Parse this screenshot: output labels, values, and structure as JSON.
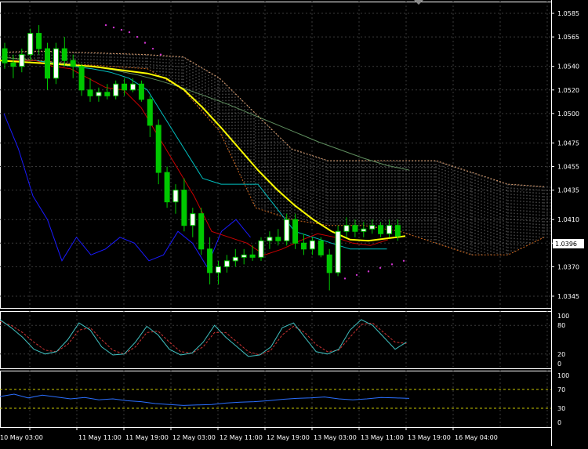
{
  "price_axis": {
    "labels": [
      "1.0585",
      "1.0565",
      "1.0540",
      "1.0520",
      "1.0500",
      "1.0475",
      "1.0455",
      "1.0435",
      "1.0410",
      "1.0390",
      "1.0370",
      "1.0345"
    ],
    "current_price": "1.0396"
  },
  "stoch_axis": {
    "labels": [
      "100",
      "80",
      "20",
      "0"
    ]
  },
  "rsi_axis": {
    "labels": [
      "100",
      "70",
      "30",
      "0"
    ]
  },
  "time_axis": {
    "labels": [
      "10 May 03:00",
      "11 May 11:00",
      "11 May 19:00",
      "12 May 03:00",
      "12 May 11:00",
      "12 May 19:00",
      "13 May 03:00",
      "13 May 11:00",
      "13 May 19:00",
      "16 May 04:00"
    ]
  },
  "colors": {
    "background": "#000000",
    "grid": "#3a3a3a",
    "axis_text": "#ffffff",
    "candle_bull": "#ffffff",
    "candle_bear": "#00c800",
    "ma_slow": "#ffff00",
    "tenkan": "#cc0000",
    "kijun": "#00c0c0",
    "chikou": "#1a1aff",
    "kumo": "#f0f0f0",
    "kumo_lower": "#d26a20",
    "psar": "#cc33cc",
    "ma_long": "#5f8f5f",
    "stoch_main": "#40c0c0",
    "stoch_signal": "#cc3333",
    "rsi_line": "#2a6fff",
    "level_line": "#c8c800"
  },
  "chart_data": [
    {
      "type": "line",
      "name_hint": "main-price-candles",
      "ylim": [
        1.0335,
        1.0595
      ],
      "candles": [
        [
          1.0555,
          1.056,
          1.0538,
          1.0543
        ],
        [
          1.0543,
          1.055,
          1.053,
          1.054
        ],
        [
          1.054,
          1.0555,
          1.0535,
          1.055
        ],
        [
          1.055,
          1.0572,
          1.0545,
          1.0568
        ],
        [
          1.0568,
          1.0575,
          1.055,
          1.0555
        ],
        [
          1.0555,
          1.056,
          1.052,
          1.053
        ],
        [
          1.053,
          1.056,
          1.0525,
          1.0555
        ],
        [
          1.0555,
          1.0565,
          1.054,
          1.0545
        ],
        [
          1.0545,
          1.055,
          1.053,
          1.054
        ],
        [
          1.054,
          1.0542,
          1.0515,
          1.052
        ],
        [
          1.052,
          1.053,
          1.051,
          1.0515
        ],
        [
          1.0515,
          1.0522,
          1.051,
          1.0518
        ],
        [
          1.0518,
          1.0525,
          1.0512,
          1.0515
        ],
        [
          1.0515,
          1.0528,
          1.0512,
          1.0525
        ],
        [
          1.0525,
          1.053,
          1.0515,
          1.052
        ],
        [
          1.052,
          1.053,
          1.0518,
          1.0525
        ],
        [
          1.0525,
          1.0528,
          1.051,
          1.0512
        ],
        [
          1.0512,
          1.0515,
          1.048,
          1.049
        ],
        [
          1.049,
          1.0495,
          1.044,
          1.045
        ],
        [
          1.045,
          1.0455,
          1.042,
          1.0425
        ],
        [
          1.0425,
          1.044,
          1.0415,
          1.0435
        ],
        [
          1.0435,
          1.0445,
          1.04,
          1.0405
        ],
        [
          1.0405,
          1.042,
          1.0395,
          1.0415
        ],
        [
          1.0415,
          1.042,
          1.038,
          1.0385
        ],
        [
          1.0385,
          1.0395,
          1.0355,
          1.0365
        ],
        [
          1.0365,
          1.0375,
          1.0355,
          1.037
        ],
        [
          1.037,
          1.038,
          1.0365,
          1.0375
        ],
        [
          1.0375,
          1.0385,
          1.037,
          1.0378
        ],
        [
          1.0378,
          1.0385,
          1.0372,
          1.038
        ],
        [
          1.038,
          1.0388,
          1.0375,
          1.0378
        ],
        [
          1.0378,
          1.0395,
          1.0375,
          1.0392
        ],
        [
          1.0392,
          1.04,
          1.0385,
          1.0395
        ],
        [
          1.0395,
          1.0402,
          1.0388,
          1.0392
        ],
        [
          1.0392,
          1.0415,
          1.0388,
          1.041
        ],
        [
          1.041,
          1.0415,
          1.0385,
          1.039
        ],
        [
          1.039,
          1.0398,
          1.038,
          1.0385
        ],
        [
          1.0385,
          1.0395,
          1.038,
          1.0392
        ],
        [
          1.0392,
          1.0395,
          1.0378,
          1.038
        ],
        [
          1.038,
          1.0385,
          1.035,
          1.0365
        ],
        [
          1.0365,
          1.0405,
          1.0362,
          1.04
        ],
        [
          1.04,
          1.0412,
          1.0395,
          1.0405
        ],
        [
          1.0405,
          1.041,
          1.0395,
          1.04
        ],
        [
          1.04,
          1.0408,
          1.0395,
          1.0402
        ],
        [
          1.0402,
          1.041,
          1.0398,
          1.0405
        ],
        [
          1.0405,
          1.0408,
          1.0395,
          1.0398
        ],
        [
          1.0398,
          1.041,
          1.0395,
          1.0405
        ],
        [
          1.0405,
          1.041,
          1.0392,
          1.0396
        ]
      ],
      "ma_slow": [
        1.0545,
        1.0544,
        1.0543,
        1.0542,
        1.0541,
        1.054,
        1.0538,
        1.0536,
        1.0534,
        1.053,
        1.052,
        1.0505,
        1.0488,
        1.047,
        1.0452,
        1.0436,
        1.0422,
        1.041,
        1.04,
        1.0393,
        1.0392,
        1.0394,
        1.0396
      ],
      "ma_long": [
        1.0548,
        1.0546,
        1.0544,
        1.0542,
        1.054,
        1.0537,
        1.0533,
        1.0528,
        1.0522,
        1.0515,
        1.0508,
        1.05,
        1.0492,
        1.0484,
        1.0476,
        1.0469,
        1.0462,
        1.0456,
        1.0452
      ],
      "tenkan": [
        1.0545,
        1.0545,
        1.0545,
        1.054,
        1.0538,
        1.053,
        1.0522,
        1.052,
        1.0505,
        1.048,
        1.0455,
        1.043,
        1.04,
        1.0395,
        1.039,
        1.038,
        1.0385,
        1.0392,
        1.0398,
        1.0395,
        1.039,
        1.0388,
        1.0393
      ],
      "kijun": [
        1.0545,
        1.0545,
        1.0545,
        1.0542,
        1.054,
        1.0538,
        1.0535,
        1.053,
        1.052,
        1.0495,
        1.047,
        1.0445,
        1.044,
        1.044,
        1.044,
        1.042,
        1.04,
        1.0395,
        1.039,
        1.0385,
        1.0385,
        1.0385
      ],
      "chikou": [
        1.05,
        1.047,
        1.043,
        1.041,
        1.0375,
        1.0395,
        1.038,
        1.0385,
        1.0395,
        1.039,
        1.0375,
        1.038,
        1.04,
        1.039,
        1.037,
        1.04,
        1.041,
        1.0395
      ],
      "psar_upper": [
        1.0575,
        1.0573,
        1.0571,
        1.0569,
        1.0565,
        1.056,
        1.0555,
        1.055
      ],
      "psar_lower": [
        1.036,
        1.0363,
        1.0366,
        1.0369,
        1.0372,
        1.0375
      ],
      "kumo_upper": [
        1.0552,
        1.0553,
        1.0552,
        1.0551,
        1.055,
        1.0548,
        1.053,
        1.05,
        1.047,
        1.046,
        1.046,
        1.046,
        1.046,
        1.045,
        1.044,
        1.0438
      ],
      "kumo_lower": [
        1.0548,
        1.0545,
        1.0542,
        1.054,
        1.0538,
        1.052,
        1.0485,
        1.042,
        1.041,
        1.0405,
        1.0405,
        1.04,
        1.039,
        1.038,
        1.038,
        1.0395
      ]
    },
    {
      "type": "line",
      "name_hint": "stochastic",
      "ylim": [
        0,
        100
      ],
      "levels": [
        80,
        20
      ],
      "series": [
        {
          "values": [
            92,
            75,
            55,
            30,
            20,
            25,
            50,
            85,
            70,
            35,
            18,
            20,
            45,
            78,
            60,
            30,
            18,
            22,
            45,
            80,
            55,
            35,
            15,
            18,
            35,
            75,
            85,
            55,
            25,
            20,
            30,
            70,
            92,
            80,
            55,
            30,
            45
          ]
        },
        {
          "values": [
            88,
            80,
            65,
            45,
            28,
            25,
            40,
            70,
            75,
            50,
            28,
            20,
            35,
            65,
            68,
            45,
            25,
            22,
            35,
            65,
            65,
            45,
            25,
            18,
            28,
            60,
            78,
            65,
            40,
            25,
            28,
            55,
            82,
            85,
            65,
            45,
            42
          ]
        }
      ]
    },
    {
      "type": "line",
      "name_hint": "rsi",
      "ylim": [
        0,
        100
      ],
      "levels": [
        70,
        30
      ],
      "series": [
        {
          "values": [
            55,
            60,
            52,
            58,
            54,
            50,
            53,
            48,
            50,
            46,
            44,
            40,
            38,
            36,
            37,
            38,
            41,
            43,
            44,
            46,
            49,
            51,
            52,
            54,
            50,
            48,
            50,
            53,
            52,
            51
          ]
        }
      ]
    }
  ]
}
